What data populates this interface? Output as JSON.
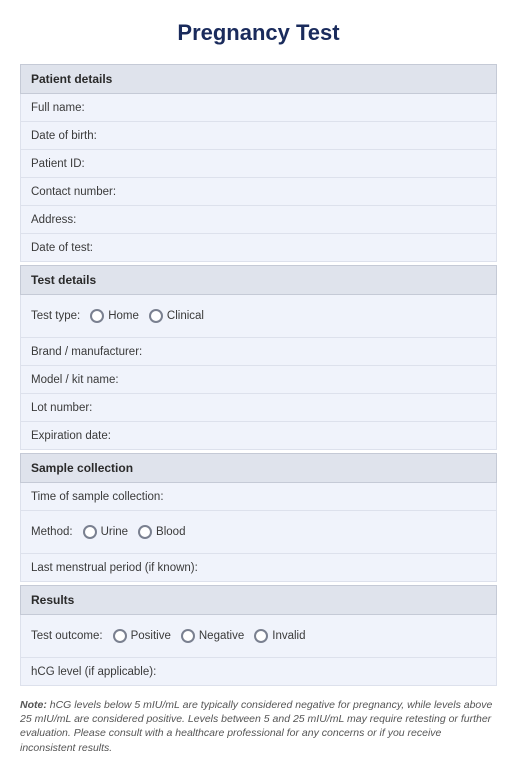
{
  "title": "Pregnancy Test",
  "sections": {
    "patient": {
      "header": "Patient details",
      "fields": {
        "full_name": "Full name:",
        "dob": "Date of birth:",
        "patient_id": "Patient ID:",
        "contact": "Contact number:",
        "address": "Address:",
        "date_of_test": "Date of test:"
      }
    },
    "test": {
      "header": "Test details",
      "test_type_label": "Test type:",
      "test_type_options": {
        "home": "Home",
        "clinical": "Clinical"
      },
      "fields": {
        "brand": "Brand / manufacturer:",
        "model": "Model / kit name:",
        "lot": "Lot number:",
        "expiration": "Expiration date:"
      }
    },
    "sample": {
      "header": "Sample collection",
      "time": "Time of sample collection:",
      "method_label": "Method:",
      "method_options": {
        "urine": "Urine",
        "blood": "Blood"
      },
      "lmp": "Last menstrual period (if known):"
    },
    "results": {
      "header": "Results",
      "outcome_label": "Test outcome:",
      "outcome_options": {
        "positive": "Positive",
        "negative": "Negative",
        "invalid": "Invalid"
      },
      "hcg": "hCG level (if applicable):"
    }
  },
  "note": {
    "label": "Note:",
    "text": " hCG levels below 5 mIU/mL are typically considered negative for pregnancy, while levels above 25 mIU/mL are considered positive. Levels between 5 and 25 mIU/mL may require retesting or further evaluation. Please consult with a healthcare professional for any concerns or if you receive inconsistent results."
  }
}
